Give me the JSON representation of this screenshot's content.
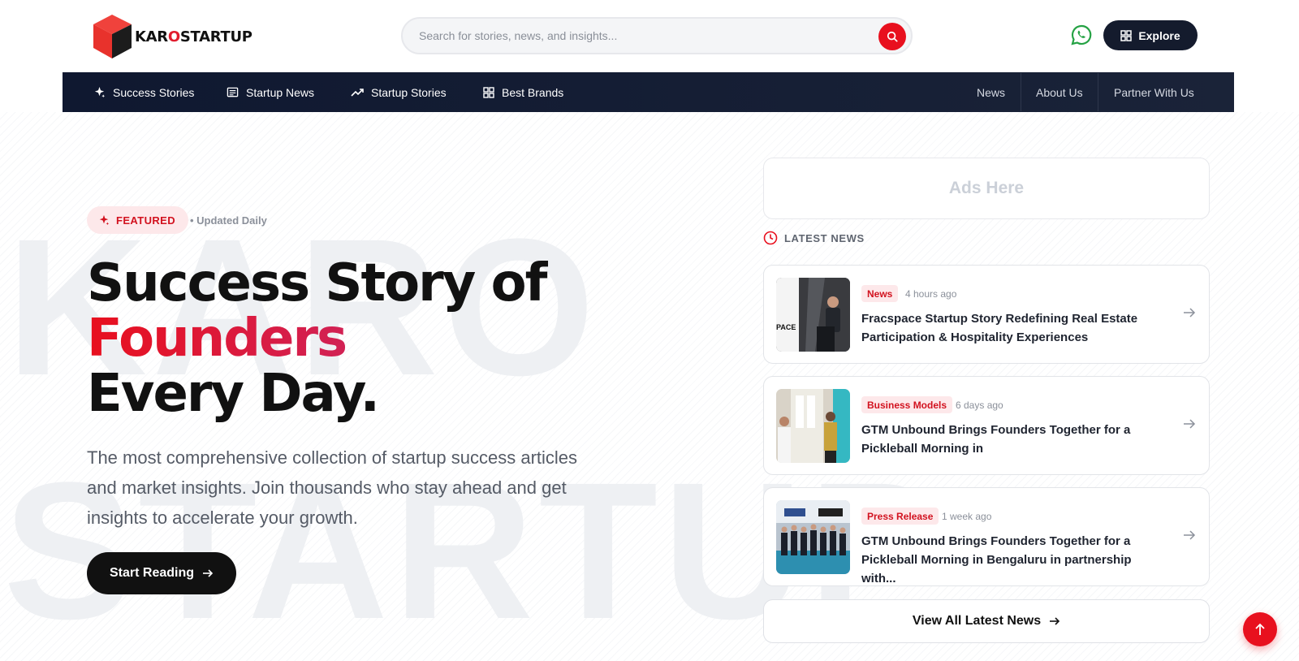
{
  "header": {
    "logo": {
      "part1": "KAR",
      "part2": "O",
      "part3": "STARTUP"
    },
    "search": {
      "placeholder": "Search for stories, news, and insights..."
    },
    "explore_label": "Explore"
  },
  "nav": {
    "left": [
      {
        "label": "Success Stories",
        "icon": "sparkle-icon"
      },
      {
        "label": "Startup News",
        "icon": "newspaper-icon"
      },
      {
        "label": "Startup Stories",
        "icon": "trending-up-icon"
      },
      {
        "label": "Best Brands",
        "icon": "grid-icon"
      }
    ],
    "right": [
      "News",
      "About Us",
      "Partner With Us"
    ]
  },
  "hero": {
    "watermark1": "KARO",
    "watermark2": "STARTUP",
    "badge": "FEATURED",
    "updated": "• Updated Daily",
    "title_line1": "Success Story of",
    "title_line2": "Founders",
    "title_line3": "Every Day.",
    "lead": "The most comprehensive collection of startup success articles and market insights. Join thousands who stay ahead and get insights to accelerate your growth.",
    "cta": "Start Reading"
  },
  "sidebar": {
    "ads": "Ads Here",
    "latest_heading": "LATEST NEWS",
    "cards": [
      {
        "tag": "News",
        "time": "4 hours ago",
        "title": "Fracspace Startup Story Redefining Real Estate Participation & Hospitality Experiences",
        "thumb_text": "PACE"
      },
      {
        "tag": "Business Models",
        "time": "6 days ago",
        "title": "GTM Unbound Brings Founders Together for a Pickleball Morning in"
      },
      {
        "tag": "Press Release",
        "time": "1 week ago",
        "title": "GTM Unbound Brings Founders Together for a Pickleball Morning in Bengaluru in partnership with..."
      }
    ],
    "view_all": "View All Latest News"
  },
  "colors": {
    "brand_red": "#e8101e",
    "navy": "#141b2d",
    "whatsapp": "#25a244"
  }
}
